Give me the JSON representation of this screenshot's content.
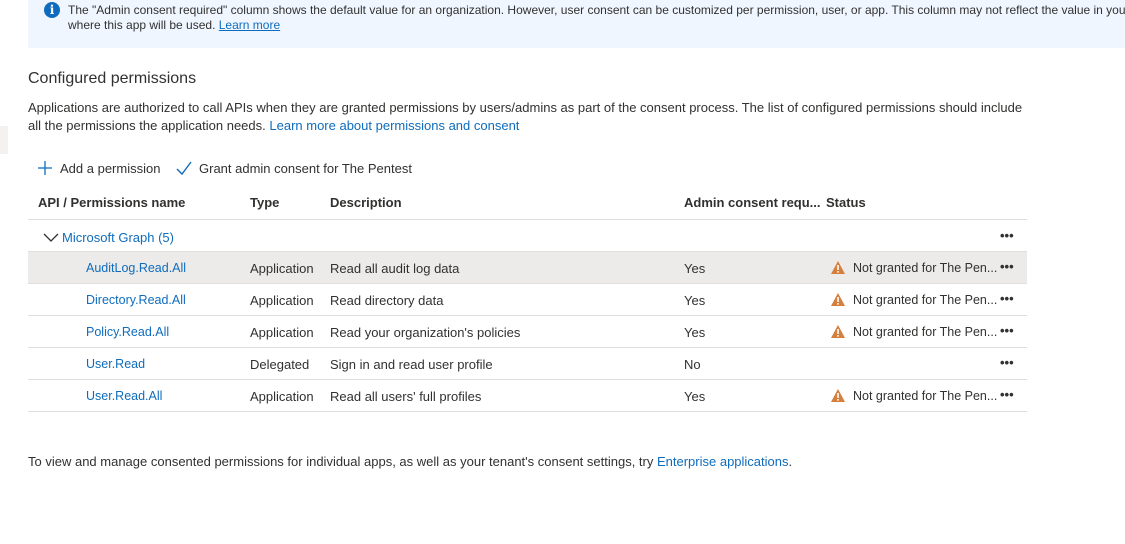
{
  "info": {
    "line1": "The \"Admin consent required\" column shows the default value for an organization. However, user consent can be customized per permission, user, or app. This column may not reflect the value in your",
    "line2_text": "where this app will be used. ",
    "learn_more": "Learn more"
  },
  "section": {
    "title": "Configured permissions",
    "desc_line1": "Applications are authorized to call APIs when they are granted permissions by users/admins as part of the consent process. The list of configured permissions should include",
    "desc_line2_text": "all the permissions the application needs. ",
    "desc_link": "Learn more about permissions and consent"
  },
  "toolbar": {
    "add_label": "Add a permission",
    "grant_label": "Grant admin consent for The Pentest"
  },
  "table": {
    "headers": {
      "name": "API / Permissions name",
      "type": "Type",
      "description": "Description",
      "admin": "Admin consent requ...",
      "status": "Status"
    },
    "group_label": "Microsoft Graph (5)",
    "more_glyph": "•••",
    "rows": [
      {
        "name": "AuditLog.Read.All",
        "type": "Application",
        "description": "Read all audit log data",
        "admin": "Yes",
        "status": "Not granted for The Pen..."
      },
      {
        "name": "Directory.Read.All",
        "type": "Application",
        "description": "Read directory data",
        "admin": "Yes",
        "status": "Not granted for The Pen..."
      },
      {
        "name": "Policy.Read.All",
        "type": "Application",
        "description": "Read your organization's policies",
        "admin": "Yes",
        "status": "Not granted for The Pen..."
      },
      {
        "name": "User.Read",
        "type": "Delegated",
        "description": "Sign in and read user profile",
        "admin": "No",
        "status": ""
      },
      {
        "name": "User.Read.All",
        "type": "Application",
        "description": "Read all users' full profiles",
        "admin": "Yes",
        "status": "Not granted for The Pen..."
      }
    ]
  },
  "footer": {
    "text": "To view and manage consented permissions for individual apps, as well as your tenant's consent settings, try ",
    "link": "Enterprise applications",
    "suffix": "."
  },
  "colors": {
    "accent": "#0f6cbd",
    "warning": "#d67f3c",
    "info_bg": "#f0f6ff",
    "selected_row": "#edebe9"
  }
}
